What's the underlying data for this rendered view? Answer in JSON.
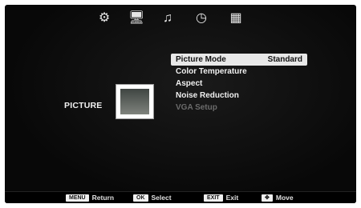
{
  "topbar": {
    "icons": [
      {
        "name": "gear-icon",
        "glyph": "⚙"
      },
      {
        "name": "monitor-icon",
        "glyph": "🖥"
      },
      {
        "name": "music-note-icon",
        "glyph": "♫"
      },
      {
        "name": "clock-icon",
        "glyph": "◷"
      },
      {
        "name": "grid-icon",
        "glyph": "▦"
      }
    ]
  },
  "section": {
    "label": "PICTURE"
  },
  "menu": {
    "items": [
      {
        "label": "Picture Mode",
        "value": "Standard",
        "selected": true,
        "disabled": false
      },
      {
        "label": "Color Temperature",
        "value": "",
        "selected": false,
        "disabled": false
      },
      {
        "label": "Aspect",
        "value": "",
        "selected": false,
        "disabled": false
      },
      {
        "label": "Noise Reduction",
        "value": "",
        "selected": false,
        "disabled": false
      },
      {
        "label": "VGA Setup",
        "value": "",
        "selected": false,
        "disabled": true
      }
    ]
  },
  "bottombar": {
    "hints": [
      {
        "key": "MENU",
        "action": "Return"
      },
      {
        "key": "OK",
        "action": "Select"
      },
      {
        "key": "EXIT",
        "action": "Exit"
      },
      {
        "key": "✥",
        "action": "Move"
      }
    ]
  },
  "colors": {
    "background": "#0a0a0a",
    "selection": "#e8e8e8",
    "text": "#f0f0f0",
    "disabled": "#6b6b6b"
  }
}
